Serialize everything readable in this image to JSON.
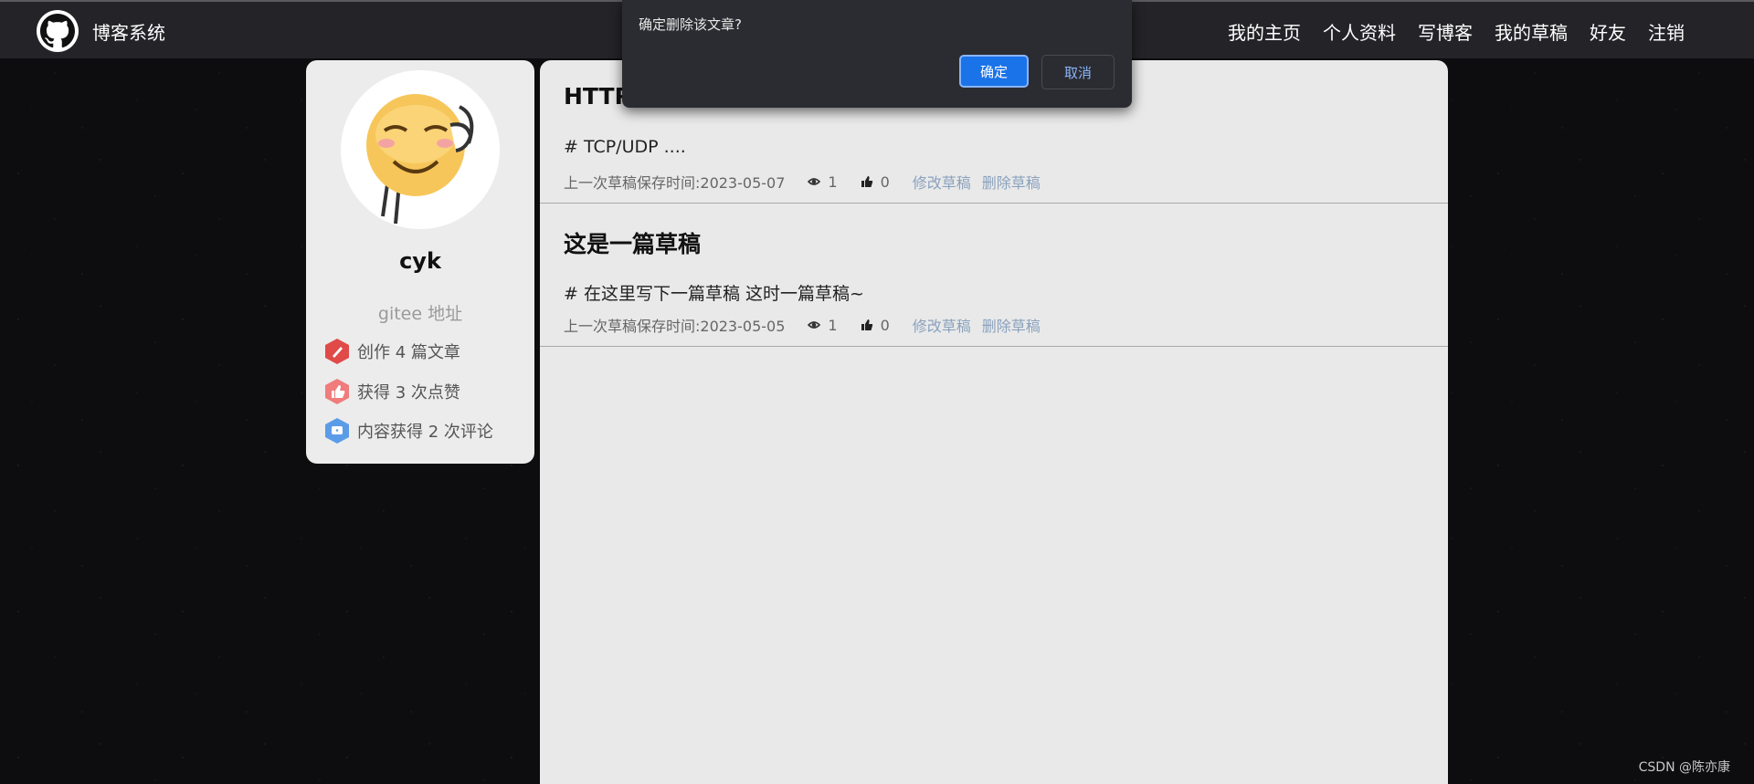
{
  "navbar": {
    "title": "博客系统",
    "links": [
      "我的主页",
      "个人资料",
      "写博客",
      "我的草稿",
      "好友",
      "注销"
    ]
  },
  "profile": {
    "username": "cyk",
    "gitee": "gitee 地址",
    "stats": [
      {
        "label": "创作 4 篇文章",
        "icon": "pen-badge-icon"
      },
      {
        "label": "获得 3 次点赞",
        "icon": "thumbs-up-badge-icon"
      },
      {
        "label": "内容获得 2 次评论",
        "icon": "comment-badge-icon"
      }
    ]
  },
  "drafts": [
    {
      "title": "HTTP",
      "desc": "# TCP/UDP ....",
      "time": "上一次草稿保存时间:2023-05-07",
      "views": "1",
      "likes": "0",
      "edit": "修改草稿",
      "delete": "删除草稿"
    },
    {
      "title": "这是一篇草稿",
      "desc": "# 在这里写下一篇草稿 这时一篇草稿~",
      "time": "上一次草稿保存时间:2023-05-05",
      "views": "1",
      "likes": "0",
      "edit": "修改草稿",
      "delete": "删除草稿"
    }
  ],
  "dialog": {
    "message": "确定删除该文章?",
    "ok": "确定",
    "cancel": "取消"
  },
  "watermark": "CSDN @陈亦康",
  "colors": {
    "dialog_primary": "#1a73e8",
    "link": "#8aa2bd",
    "panel": "#e9e9e9"
  }
}
